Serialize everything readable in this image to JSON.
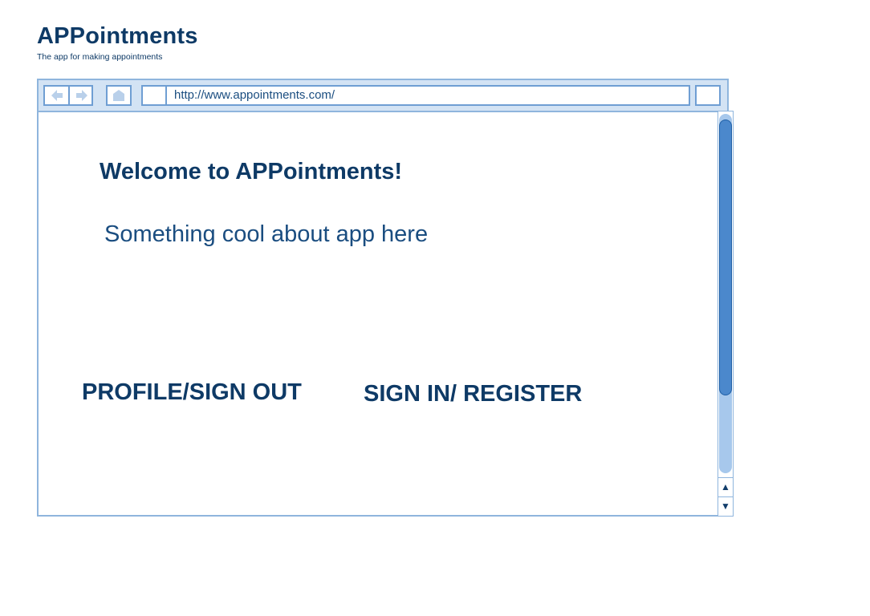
{
  "header": {
    "title": "APPointments",
    "subtitle": "The app for making appointments"
  },
  "browser": {
    "url": "http://www.appointments.com/",
    "icons": {
      "back": "back-arrow-icon",
      "forward": "forward-arrow-icon",
      "home": "home-icon",
      "scroll_up": "triangle-up-icon",
      "scroll_down": "triangle-down-icon"
    }
  },
  "main": {
    "welcome": "Welcome to APPointments!",
    "tagline": "Something cool about app here",
    "profile_link": "PROFILE/SIGN OUT",
    "signin_link": "SIGN IN/ REGISTER"
  },
  "colors": {
    "primary_text": "#0e3a66",
    "frame_border": "#8fb5dd",
    "toolbar_bg": "#d3e3f4",
    "scroll_thumb": "#4b88cc"
  }
}
